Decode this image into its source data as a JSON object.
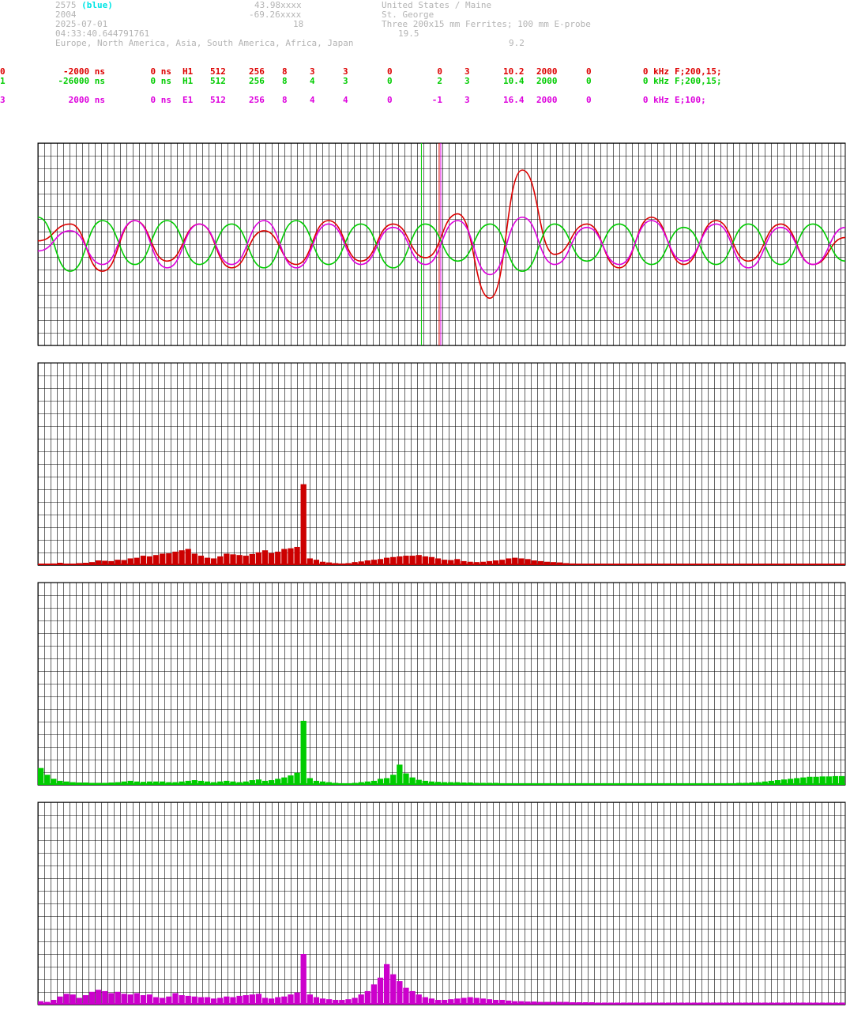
{
  "header": {
    "station_id": "2575",
    "station_color_label": "(blue)",
    "latitude": "43.98xxxx",
    "country_region": "United States / Maine",
    "year": "2004",
    "longitude": "-69.26xxxx",
    "city": "St. George",
    "date": "2025-07-01",
    "value_18": "18",
    "antenna": "Three 200x15 mm Ferrites; 100 mm E-probe",
    "time": "04:33:40.644791761",
    "value_19_5": "19.5",
    "regions": "Europe, North America, Asia, South America, Africa, Japan",
    "value_9_2": "9.2"
  },
  "channels": [
    {
      "name": "0",
      "color": "#dd0000",
      "cols": [
        "0",
        "-2000 ns",
        "0 ns",
        "H1",
        "512",
        "256",
        "8",
        "3",
        "3",
        "0",
        "0",
        "3",
        "10.2",
        "2000",
        "0",
        "0 kHz",
        "F;200,15;"
      ]
    },
    {
      "name": "1",
      "color": "#00cc00",
      "cols": [
        "1",
        "-26000 ns",
        "0 ns",
        "H1",
        "512",
        "256",
        "8",
        "4",
        "3",
        "0",
        "2",
        "3",
        "10.4",
        "2000",
        "0",
        "0 kHz",
        "F;200,15;"
      ]
    },
    {
      "name": "3",
      "color": "#dd00dd",
      "cols": [
        "3",
        "2000 ns",
        "0 ns",
        "E1",
        "512",
        "256",
        "8",
        "4",
        "4",
        "0",
        "-1",
        "3",
        "16.4",
        "2000",
        "0",
        "0 kHz",
        "E;100;"
      ]
    }
  ],
  "chart_data": [
    {
      "type": "line",
      "panel": "time-domain waveforms",
      "x": [
        0,
        4,
        8,
        12,
        16,
        20,
        24,
        28,
        32,
        36,
        40,
        44,
        48,
        52,
        56,
        60,
        64,
        68,
        72,
        76,
        80,
        84,
        88,
        92,
        96,
        100
      ],
      "series": [
        {
          "name": "0",
          "color": "#dd0000",
          "values": [
            0.1,
            0.6,
            -0.8,
            0.7,
            -0.5,
            0.6,
            -0.7,
            0.4,
            -0.6,
            0.7,
            -0.5,
            0.6,
            -0.4,
            0.9,
            -1.6,
            2.2,
            -0.3,
            0.6,
            -0.7,
            0.8,
            -0.6,
            0.7,
            -0.5,
            0.6,
            -0.6,
            0.2
          ]
        },
        {
          "name": "1",
          "color": "#00cc00",
          "values": [
            0.8,
            -0.8,
            0.7,
            -0.6,
            0.7,
            -0.6,
            0.6,
            -0.7,
            0.7,
            -0.6,
            0.6,
            -0.7,
            0.6,
            -0.5,
            0.6,
            -0.8,
            0.6,
            -0.5,
            0.6,
            -0.6,
            0.5,
            -0.6,
            0.6,
            -0.6,
            0.6,
            -0.5
          ]
        },
        {
          "name": "3",
          "color": "#dd00dd",
          "values": [
            -0.2,
            0.4,
            -0.6,
            0.7,
            -0.7,
            0.6,
            -0.6,
            0.7,
            -0.7,
            0.6,
            -0.6,
            0.5,
            -0.6,
            0.7,
            -0.9,
            0.8,
            -0.6,
            0.5,
            -0.6,
            0.7,
            -0.5,
            0.6,
            -0.7,
            0.5,
            -0.6,
            0.5
          ]
        }
      ],
      "markers": [
        {
          "color": "#00cc00",
          "x": 47.5
        },
        {
          "color": "#dd0000",
          "x": 49.7
        },
        {
          "color": "#dd00dd",
          "x": 49.9
        }
      ],
      "ylim": [
        -3,
        3
      ],
      "grid": true
    },
    {
      "type": "bar",
      "panel": "spectrum channel 0",
      "color": "#cc0000",
      "values": [
        0.03,
        0.03,
        0.05,
        0.07,
        0.04,
        0.04,
        0.06,
        0.07,
        0.09,
        0.14,
        0.13,
        0.12,
        0.16,
        0.15,
        0.2,
        0.22,
        0.28,
        0.26,
        0.3,
        0.34,
        0.35,
        0.4,
        0.44,
        0.48,
        0.34,
        0.28,
        0.22,
        0.2,
        0.26,
        0.34,
        0.32,
        0.3,
        0.28,
        0.33,
        0.38,
        0.44,
        0.36,
        0.4,
        0.48,
        0.5,
        0.54,
        2.4,
        0.2,
        0.16,
        0.1,
        0.08,
        0.06,
        0.05,
        0.06,
        0.09,
        0.11,
        0.14,
        0.16,
        0.18,
        0.22,
        0.24,
        0.26,
        0.28,
        0.28,
        0.3,
        0.26,
        0.24,
        0.2,
        0.16,
        0.15,
        0.18,
        0.12,
        0.1,
        0.09,
        0.1,
        0.12,
        0.14,
        0.16,
        0.2,
        0.22,
        0.2,
        0.18,
        0.14,
        0.12,
        0.1,
        0.09,
        0.08,
        0.06,
        0.05,
        0.04,
        0.04,
        0.03,
        0.03,
        0.03,
        0.03,
        0.03,
        0.03,
        0.03,
        0.03,
        0.03,
        0.03,
        0.03,
        0.03,
        0.03,
        0.03,
        0.03,
        0.03,
        0.03,
        0.03,
        0.03,
        0.03,
        0.03,
        0.03,
        0.03,
        0.03,
        0.02,
        0.02,
        0.02,
        0.02,
        0.02,
        0.02,
        0.02,
        0.02,
        0.02,
        0.02,
        0.02,
        0.02,
        0.02,
        0.02,
        0.02,
        0.02
      ],
      "ylim": [
        0,
        6
      ]
    },
    {
      "type": "bar",
      "panel": "spectrum channel 1",
      "color": "#00cc00",
      "values": [
        0.5,
        0.3,
        0.18,
        0.12,
        0.1,
        0.08,
        0.07,
        0.07,
        0.06,
        0.06,
        0.06,
        0.07,
        0.08,
        0.1,
        0.12,
        0.1,
        0.09,
        0.1,
        0.1,
        0.1,
        0.08,
        0.08,
        0.1,
        0.12,
        0.14,
        0.12,
        0.1,
        0.08,
        0.1,
        0.12,
        0.1,
        0.08,
        0.1,
        0.14,
        0.16,
        0.12,
        0.14,
        0.18,
        0.22,
        0.28,
        0.36,
        1.9,
        0.2,
        0.12,
        0.1,
        0.08,
        0.06,
        0.05,
        0.05,
        0.06,
        0.08,
        0.1,
        0.12,
        0.18,
        0.2,
        0.3,
        0.6,
        0.34,
        0.22,
        0.15,
        0.12,
        0.1,
        0.09,
        0.08,
        0.08,
        0.08,
        0.07,
        0.07,
        0.06,
        0.06,
        0.06,
        0.06,
        0.05,
        0.05,
        0.05,
        0.05,
        0.05,
        0.05,
        0.05,
        0.05,
        0.05,
        0.05,
        0.05,
        0.05,
        0.05,
        0.05,
        0.05,
        0.05,
        0.05,
        0.05,
        0.05,
        0.05,
        0.05,
        0.05,
        0.05,
        0.05,
        0.05,
        0.05,
        0.05,
        0.05,
        0.05,
        0.05,
        0.05,
        0.05,
        0.05,
        0.05,
        0.05,
        0.05,
        0.05,
        0.06,
        0.06,
        0.07,
        0.08,
        0.1,
        0.12,
        0.14,
        0.16,
        0.18,
        0.2,
        0.22,
        0.24,
        0.24,
        0.25,
        0.25,
        0.26,
        0.26
      ],
      "ylim": [
        0,
        6
      ]
    },
    {
      "type": "bar",
      "panel": "spectrum channel 3",
      "color": "#cc00cc",
      "values": [
        0.1,
        0.08,
        0.14,
        0.24,
        0.32,
        0.3,
        0.2,
        0.28,
        0.38,
        0.44,
        0.4,
        0.34,
        0.38,
        0.32,
        0.3,
        0.34,
        0.28,
        0.3,
        0.22,
        0.2,
        0.24,
        0.34,
        0.28,
        0.26,
        0.24,
        0.22,
        0.22,
        0.18,
        0.2,
        0.24,
        0.22,
        0.26,
        0.28,
        0.3,
        0.32,
        0.2,
        0.18,
        0.22,
        0.24,
        0.3,
        0.36,
        1.5,
        0.3,
        0.22,
        0.18,
        0.16,
        0.14,
        0.14,
        0.16,
        0.2,
        0.3,
        0.4,
        0.6,
        0.8,
        1.2,
        0.9,
        0.7,
        0.5,
        0.4,
        0.3,
        0.22,
        0.18,
        0.14,
        0.14,
        0.16,
        0.18,
        0.2,
        0.22,
        0.2,
        0.18,
        0.16,
        0.14,
        0.14,
        0.12,
        0.1,
        0.1,
        0.09,
        0.09,
        0.08,
        0.08,
        0.08,
        0.08,
        0.08,
        0.07,
        0.07,
        0.07,
        0.07,
        0.06,
        0.06,
        0.06,
        0.06,
        0.06,
        0.06,
        0.06,
        0.06,
        0.06,
        0.06,
        0.06,
        0.06,
        0.06,
        0.06,
        0.06,
        0.06,
        0.06,
        0.06,
        0.06,
        0.06,
        0.06,
        0.06,
        0.06,
        0.06,
        0.06,
        0.06,
        0.06,
        0.06,
        0.06,
        0.06,
        0.06,
        0.06,
        0.06,
        0.06,
        0.06,
        0.06,
        0.06,
        0.06,
        0.06
      ],
      "ylim": [
        0,
        6
      ]
    }
  ]
}
